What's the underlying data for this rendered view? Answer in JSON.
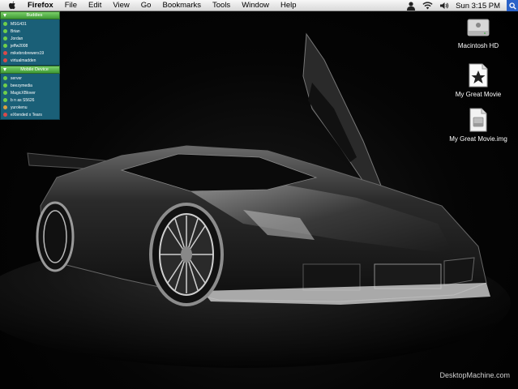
{
  "menubar": {
    "app": "Firefox",
    "menus": [
      "File",
      "Edit",
      "View",
      "Go",
      "Bookmarks",
      "Tools",
      "Window",
      "Help"
    ],
    "clock": "Sun 3:15 PM"
  },
  "buddy_panel": {
    "groups": [
      {
        "title": "Buddies",
        "buddies": [
          {
            "name": "MSG431",
            "color": "#6fcf4a"
          },
          {
            "name": "Brian",
            "color": "#6fcf4a"
          },
          {
            "name": "Jordan",
            "color": "#6fcf4a"
          },
          {
            "name": "jeffw2008",
            "color": "#6fcf4a"
          },
          {
            "name": "mikebrobrewers19",
            "color": "#d94a4a"
          },
          {
            "name": "virtualmadden",
            "color": "#d94a4a"
          }
        ]
      },
      {
        "title": "Mobile Device",
        "buddies": [
          {
            "name": "server",
            "color": "#6fcf4a"
          },
          {
            "name": "beezymedia",
            "color": "#6fcf4a"
          },
          {
            "name": "MagicXBlover",
            "color": "#6fcf4a"
          },
          {
            "name": "b n as S5626",
            "color": "#6fcf4a"
          },
          {
            "name": "yurokenu",
            "color": "#d9a040"
          },
          {
            "name": "eXtended x Tears",
            "color": "#d94a4a"
          }
        ]
      }
    ]
  },
  "desktop_icons": [
    {
      "label": "Macintosh HD",
      "icon": "hard-drive-icon"
    },
    {
      "label": "My Great Movie",
      "icon": "movie-icon"
    },
    {
      "label": "My Great Movie.img",
      "icon": "disk-image-icon"
    }
  ],
  "watermark": "DesktopMachine.com"
}
